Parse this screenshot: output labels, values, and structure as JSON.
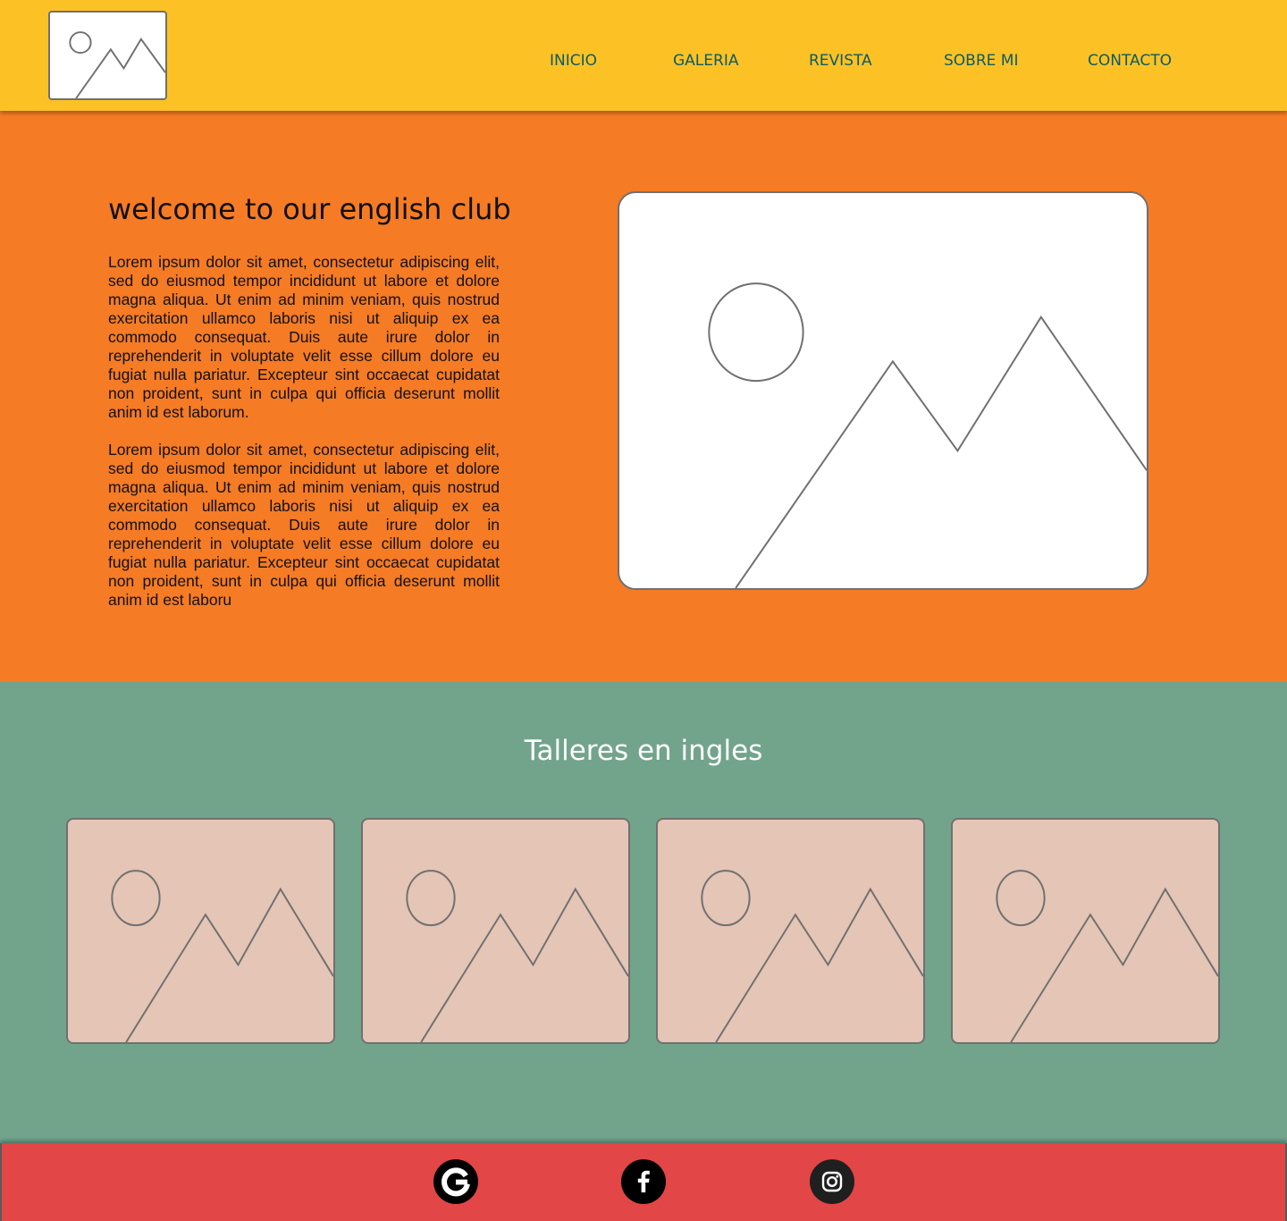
{
  "header": {
    "logo_icon": "image-placeholder-icon",
    "nav": [
      {
        "label": "INICIO"
      },
      {
        "label": "GALERIA"
      },
      {
        "label": "REVISTA"
      },
      {
        "label": "SOBRE MI"
      },
      {
        "label": "CONTACTO"
      }
    ]
  },
  "hero": {
    "title": "welcome to our english club",
    "paragraphs": [
      "Lorem ipsum dolor sit amet, consectetur adipiscing elit, sed do eiusmod tempor incididunt ut labore et dolore magna aliqua. Ut enim ad minim veniam, quis nostrud exercitation ullamco laboris nisi ut aliquip ex ea commodo consequat. Duis aute irure dolor in reprehenderit in voluptate velit esse cillum dolore eu fugiat nulla pariatur. Excepteur sint occaecat cupidatat non proident, sunt in culpa qui officia deserunt mollit anim id est laborum.",
      "Lorem ipsum dolor sit amet, consectetur adipiscing elit, sed do eiusmod tempor incididunt ut labore et dolore magna aliqua. Ut enim ad minim veniam, quis nostrud exercitation ullamco laboris nisi ut aliquip ex ea commodo consequat. Duis aute irure dolor in reprehenderit in voluptate velit esse cillum dolore eu fugiat nulla pariatur. Excepteur sint occaecat cupidatat non proident, sunt in culpa qui officia deserunt mollit anim id est laboru"
    ],
    "image_icon": "image-placeholder-icon"
  },
  "workshops": {
    "title": "Talleres en ingles",
    "cards": [
      {
        "icon": "image-placeholder-icon"
      },
      {
        "icon": "image-placeholder-icon"
      },
      {
        "icon": "image-placeholder-icon"
      },
      {
        "icon": "image-placeholder-icon"
      }
    ]
  },
  "footer": {
    "social": [
      {
        "icon": "google-icon"
      },
      {
        "icon": "facebook-icon"
      },
      {
        "icon": "instagram-icon"
      }
    ]
  },
  "colors": {
    "header_bg": "#FCC225",
    "nav_text": "#0E5B62",
    "hero_bg": "#F57B25",
    "workshops_bg": "#72A48C",
    "card_bg": "#E4C5B6",
    "footer_bg": "#E24646",
    "placeholder_stroke": "#707070"
  }
}
